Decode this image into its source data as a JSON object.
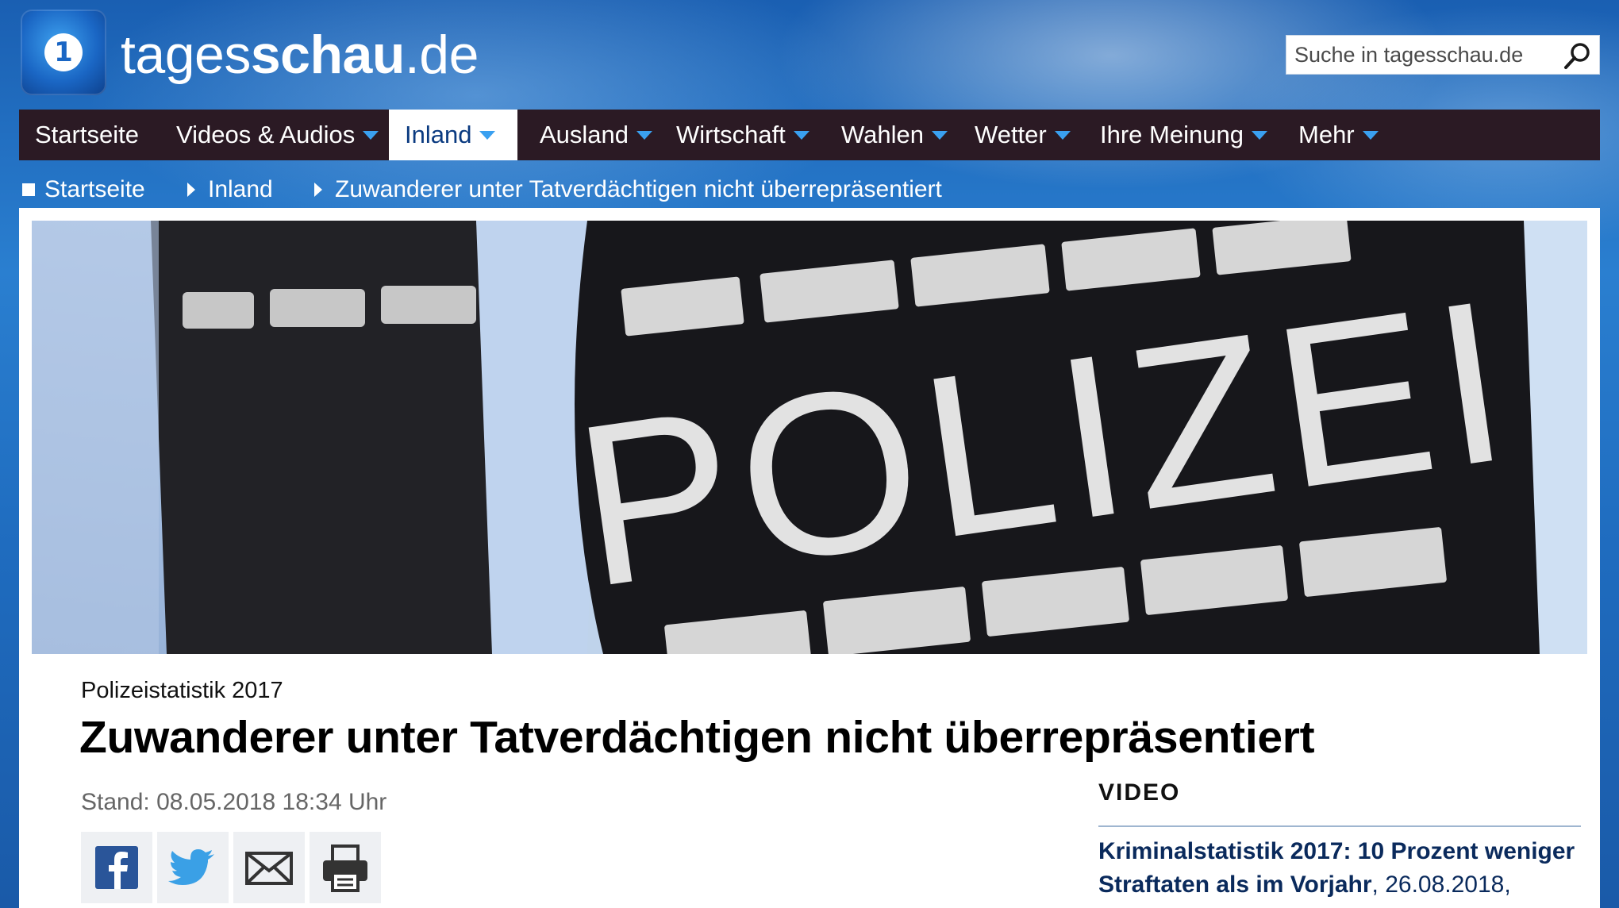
{
  "header": {
    "brand_light": "tages",
    "brand_bold": "schau",
    "brand_suffix": ".de",
    "logo_icon": "tagesschau-logo-icon",
    "search_placeholder": "Suche in tagesschau.de"
  },
  "nav": {
    "items": [
      {
        "label": "Startseite"
      },
      {
        "label": "Videos & Audios"
      },
      {
        "label": "Inland"
      },
      {
        "label": "Ausland"
      },
      {
        "label": "Wirtschaft"
      },
      {
        "label": "Wahlen"
      },
      {
        "label": "Wetter"
      },
      {
        "label": "Ihre Meinung"
      },
      {
        "label": "Mehr"
      }
    ],
    "active": "Inland"
  },
  "breadcrumb": {
    "items": [
      "Startseite",
      "Inland",
      "Zuwanderer unter Tatverdächtigen nicht überrepräsentiert"
    ]
  },
  "article": {
    "hero_text": "POLIZEI",
    "topline": "Polizeistatistik 2017",
    "headline": "Zuwanderer unter Tatverdächtigen nicht überrepräsentiert",
    "stand": "Stand: 08.05.2018 18:34 Uhr",
    "share_icons": [
      "facebook-icon",
      "twitter-icon",
      "mail-icon",
      "print-icon"
    ]
  },
  "sidebar": {
    "label": "VIDEO",
    "video_title": "Kriminalstatistik 2017: 10 Prozent weniger Straftaten als im Vorjahr",
    "video_date": ", 26.08.2018,"
  },
  "colors": {
    "nav_bg": "#2b1a24",
    "caret": "#3aa0f0",
    "active_text": "#0a3a80",
    "link_dark": "#0a2a5c"
  }
}
